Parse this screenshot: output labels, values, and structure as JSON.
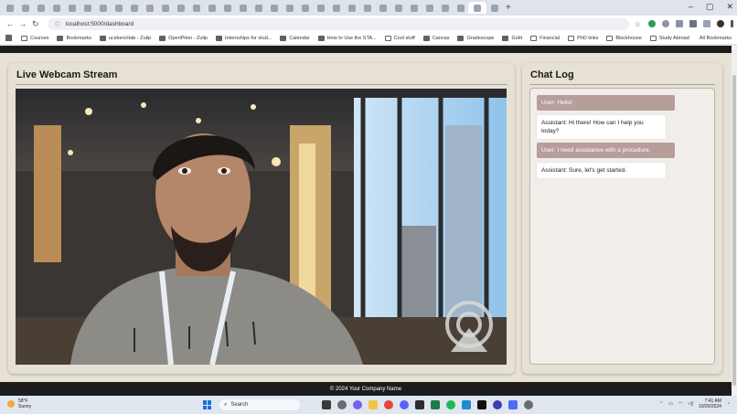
{
  "browser": {
    "tab_count": 32,
    "active_tab_index": 30,
    "url": "localhost:5000/dashboard",
    "bookmarks": [
      {
        "label": "Courses",
        "kind": "folder"
      },
      {
        "label": "Bookmarks",
        "kind": "star"
      },
      {
        "label": "ucsbercHab - Zulip",
        "kind": "site"
      },
      {
        "label": "OpenPiton - Zulip",
        "kind": "site"
      },
      {
        "label": "Internships for stud...",
        "kind": "site"
      },
      {
        "label": "Calendar",
        "kind": "site"
      },
      {
        "label": "How to Use the STA...",
        "kind": "site"
      },
      {
        "label": "Cool stuff",
        "kind": "folder"
      },
      {
        "label": "Canvas",
        "kind": "site"
      },
      {
        "label": "Gradescope",
        "kind": "site"
      },
      {
        "label": "Gold",
        "kind": "site"
      },
      {
        "label": "Financial",
        "kind": "folder"
      },
      {
        "label": "PhD links",
        "kind": "folder"
      },
      {
        "label": "Blockhouse",
        "kind": "folder"
      },
      {
        "label": "Study Abroad",
        "kind": "folder"
      }
    ],
    "all_bookmarks_label": "All Bookmarks"
  },
  "webcam": {
    "title": "Live Webcam Stream"
  },
  "chat": {
    "title": "Chat Log",
    "messages": [
      {
        "role": "user",
        "text": "User: Hello!"
      },
      {
        "role": "assistant",
        "text": "Assistant: Hi there! How can I help you today?"
      },
      {
        "role": "user",
        "text": "User: I need assistance with a procedure."
      },
      {
        "role": "assistant",
        "text": "Assistant: Sure, let's get started."
      }
    ]
  },
  "footer": {
    "text": "© 2024 Your Company Name"
  },
  "taskbar": {
    "weather_temp": "58°F",
    "weather_desc": "Sunny",
    "search_placeholder": "Search",
    "time": "7:41 AM",
    "date": "10/20/2024"
  },
  "colors": {
    "page_bg": "#e8e2d6",
    "header_bar": "#1c1c1c",
    "user_bubble": "#b79e9b",
    "assistant_bubble": "#ffffff"
  }
}
